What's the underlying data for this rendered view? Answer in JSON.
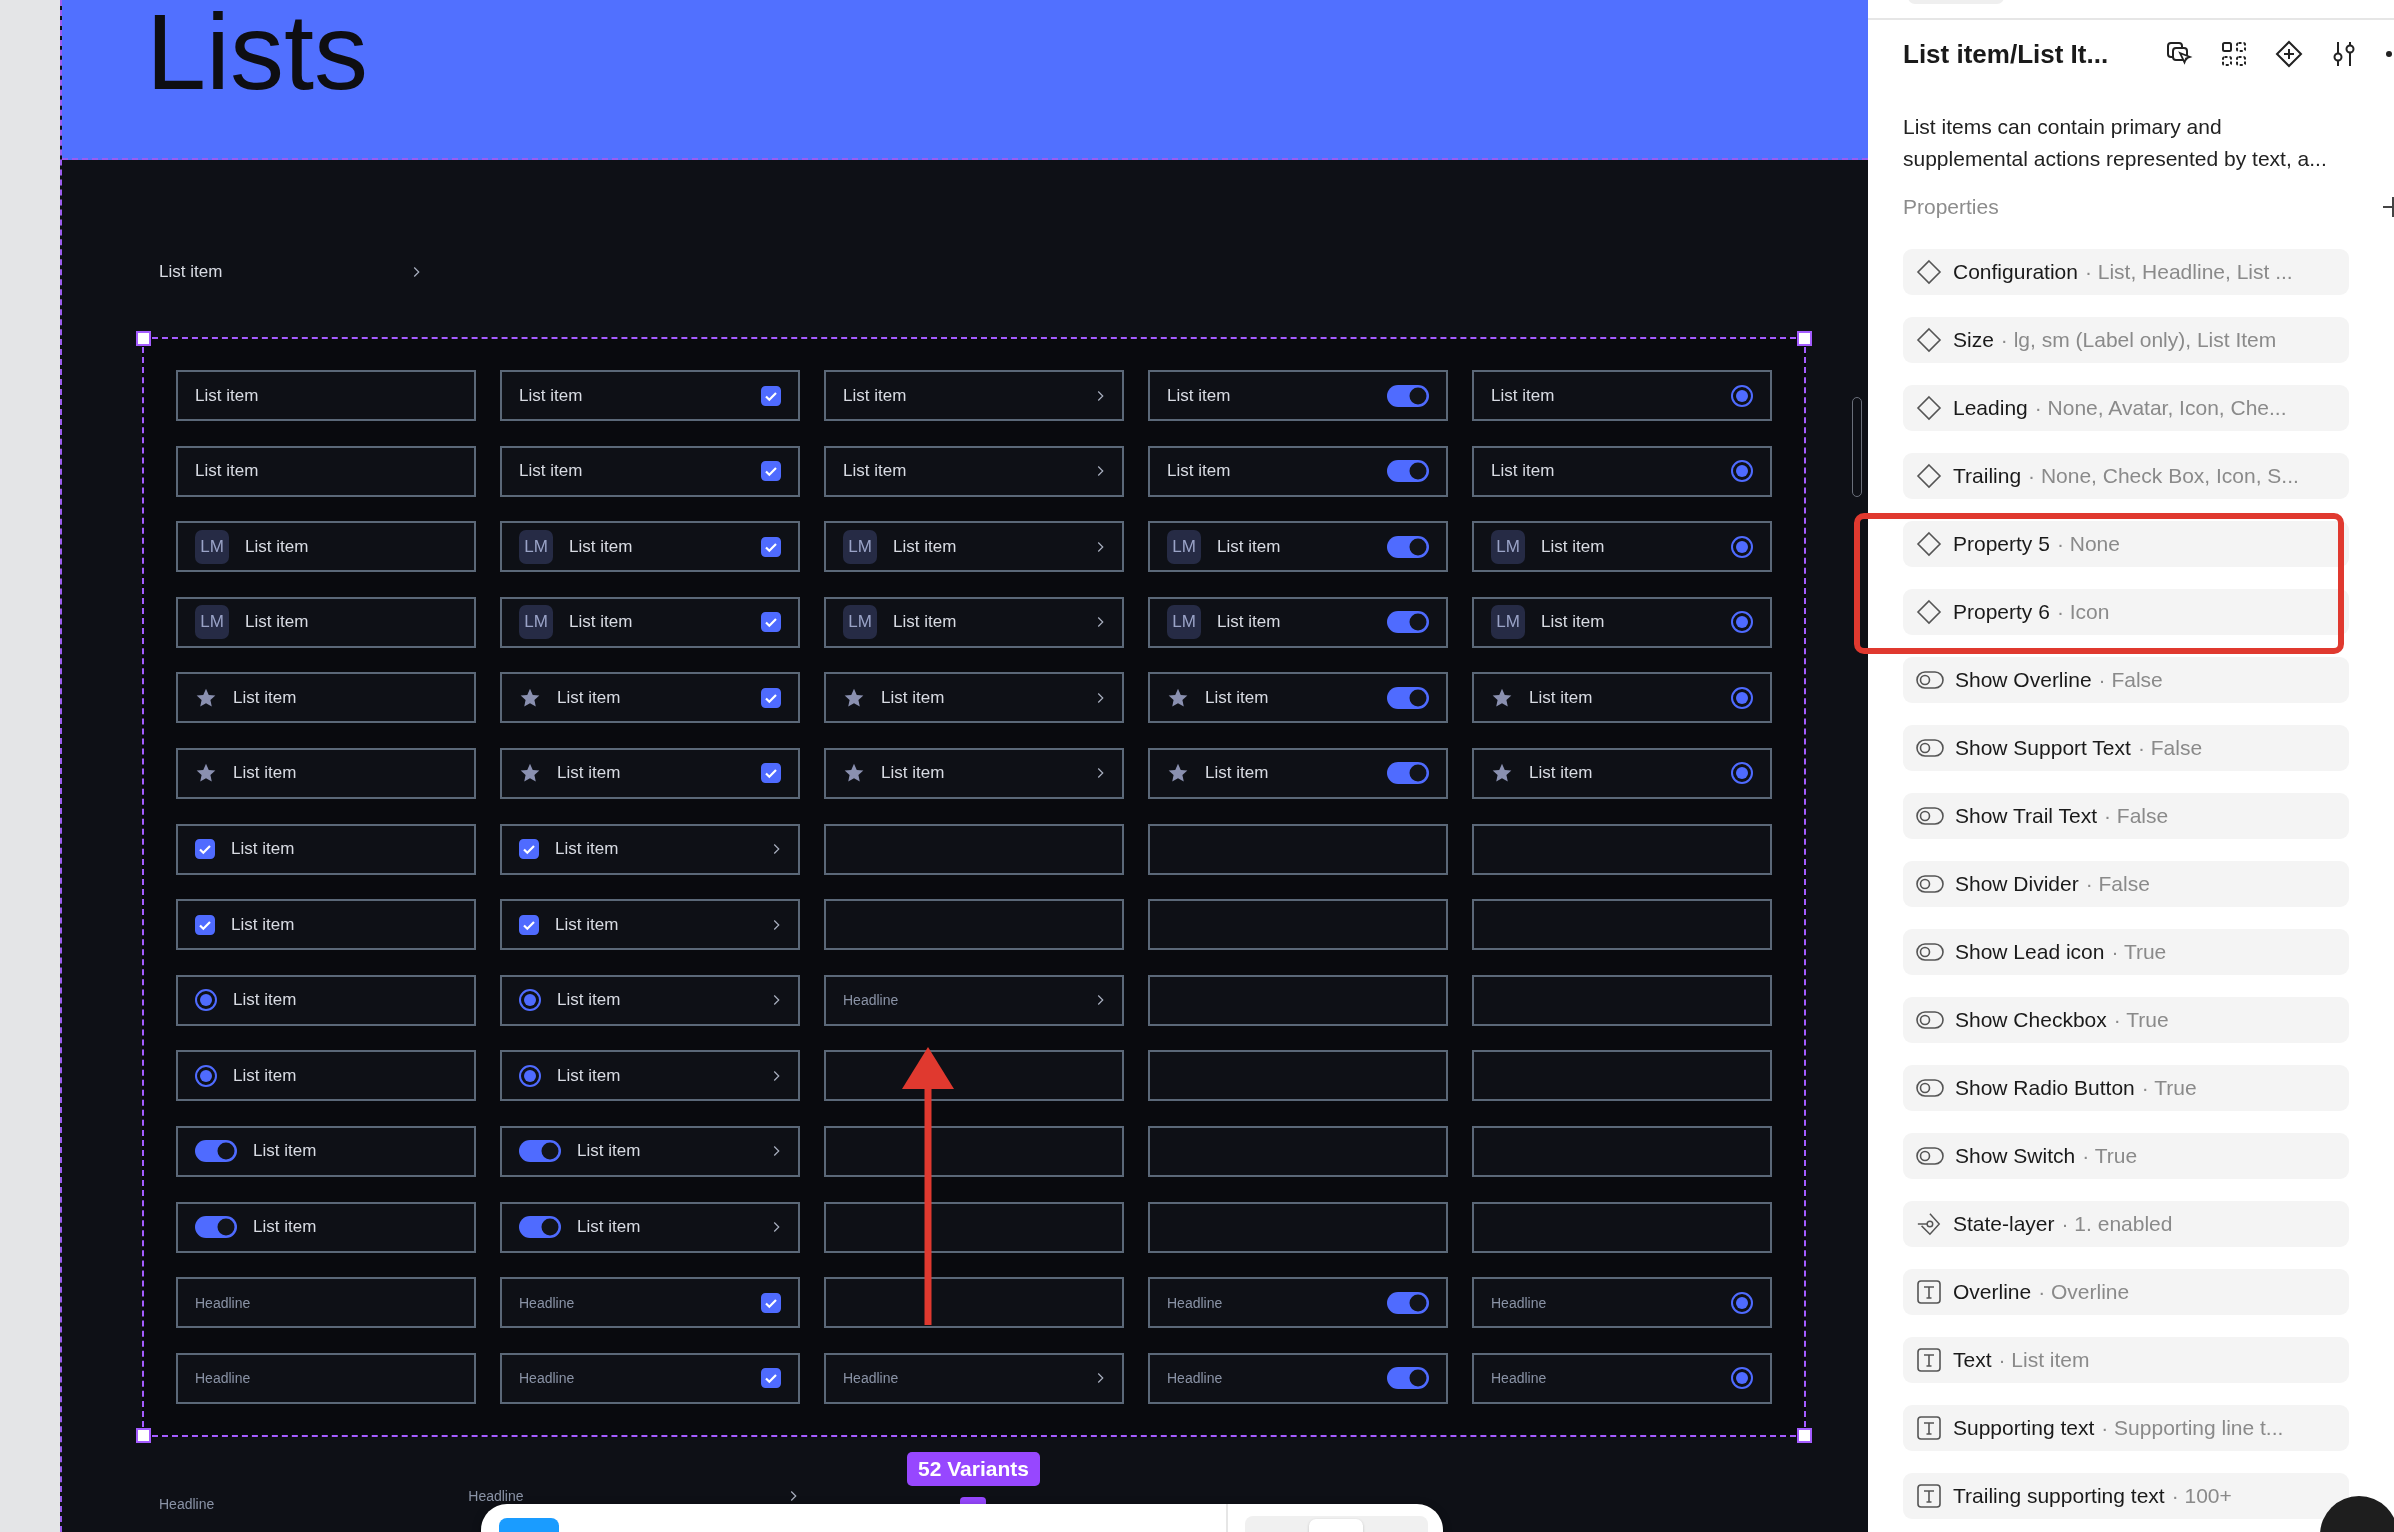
{
  "canvas": {
    "title": "Lists",
    "sample_item": {
      "label": "List item"
    },
    "variants": {
      "badge": "52 Variants",
      "rows": [
        {
          "cells": [
            {
              "kind": "item",
              "label": "List item"
            },
            {
              "kind": "item",
              "label": "List item",
              "trailing": {
                "kind": "checkbox",
                "checked": true
              }
            },
            {
              "kind": "item",
              "label": "List item",
              "trailing": {
                "kind": "chevron"
              }
            },
            {
              "kind": "item",
              "label": "List item",
              "trailing": {
                "kind": "switch",
                "checked": true
              }
            },
            {
              "kind": "item",
              "label": "List item",
              "trailing": {
                "kind": "radio",
                "checked": true
              }
            }
          ]
        },
        {
          "cells": [
            {
              "kind": "item",
              "label": "List item"
            },
            {
              "kind": "item",
              "label": "List item",
              "trailing": {
                "kind": "checkbox",
                "checked": true
              }
            },
            {
              "kind": "item",
              "label": "List item",
              "trailing": {
                "kind": "chevron"
              }
            },
            {
              "kind": "item",
              "label": "List item",
              "trailing": {
                "kind": "switch",
                "checked": true
              }
            },
            {
              "kind": "item",
              "label": "List item",
              "trailing": {
                "kind": "radio",
                "checked": true
              }
            }
          ]
        },
        {
          "cells": [
            {
              "kind": "item",
              "leading": {
                "kind": "avatar",
                "text": "LM"
              },
              "label": "List item"
            },
            {
              "kind": "item",
              "leading": {
                "kind": "avatar",
                "text": "LM"
              },
              "label": "List item",
              "trailing": {
                "kind": "checkbox",
                "checked": true
              }
            },
            {
              "kind": "item",
              "leading": {
                "kind": "avatar",
                "text": "LM"
              },
              "label": "List item",
              "trailing": {
                "kind": "chevron"
              }
            },
            {
              "kind": "item",
              "leading": {
                "kind": "avatar",
                "text": "LM"
              },
              "label": "List item",
              "trailing": {
                "kind": "switch",
                "checked": true
              }
            },
            {
              "kind": "item",
              "leading": {
                "kind": "avatar",
                "text": "LM"
              },
              "label": "List item",
              "trailing": {
                "kind": "radio",
                "checked": true
              }
            }
          ]
        },
        {
          "cells": [
            {
              "kind": "item",
              "leading": {
                "kind": "avatar",
                "text": "LM"
              },
              "label": "List item"
            },
            {
              "kind": "item",
              "leading": {
                "kind": "avatar",
                "text": "LM"
              },
              "label": "List item",
              "trailing": {
                "kind": "checkbox",
                "checked": true
              }
            },
            {
              "kind": "item",
              "leading": {
                "kind": "avatar",
                "text": "LM"
              },
              "label": "List item",
              "trailing": {
                "kind": "chevron"
              }
            },
            {
              "kind": "item",
              "leading": {
                "kind": "avatar",
                "text": "LM"
              },
              "label": "List item",
              "trailing": {
                "kind": "switch",
                "checked": true
              }
            },
            {
              "kind": "item",
              "leading": {
                "kind": "avatar",
                "text": "LM"
              },
              "label": "List item",
              "trailing": {
                "kind": "radio",
                "checked": true
              }
            }
          ]
        },
        {
          "cells": [
            {
              "kind": "item",
              "leading": {
                "kind": "star"
              },
              "label": "List item"
            },
            {
              "kind": "item",
              "leading": {
                "kind": "star"
              },
              "label": "List item",
              "trailing": {
                "kind": "checkbox",
                "checked": true
              }
            },
            {
              "kind": "item",
              "leading": {
                "kind": "star"
              },
              "label": "List item",
              "trailing": {
                "kind": "chevron"
              }
            },
            {
              "kind": "item",
              "leading": {
                "kind": "star"
              },
              "label": "List item",
              "trailing": {
                "kind": "switch",
                "checked": true
              }
            },
            {
              "kind": "item",
              "leading": {
                "kind": "star"
              },
              "label": "List item",
              "trailing": {
                "kind": "radio",
                "checked": true
              }
            }
          ]
        },
        {
          "cells": [
            {
              "kind": "item",
              "leading": {
                "kind": "star"
              },
              "label": "List item"
            },
            {
              "kind": "item",
              "leading": {
                "kind": "star"
              },
              "label": "List item",
              "trailing": {
                "kind": "checkbox",
                "checked": true
              }
            },
            {
              "kind": "item",
              "leading": {
                "kind": "star"
              },
              "label": "List item",
              "trailing": {
                "kind": "chevron"
              }
            },
            {
              "kind": "item",
              "leading": {
                "kind": "star"
              },
              "label": "List item",
              "trailing": {
                "kind": "switch",
                "checked": true
              }
            },
            {
              "kind": "item",
              "leading": {
                "kind": "star"
              },
              "label": "List item",
              "trailing": {
                "kind": "radio",
                "checked": true
              }
            }
          ]
        },
        {
          "cells": [
            {
              "kind": "item",
              "leading": {
                "kind": "checkbox",
                "checked": true
              },
              "label": "List item"
            },
            {
              "kind": "item",
              "leading": {
                "kind": "checkbox",
                "checked": true
              },
              "label": "List item",
              "trailing": {
                "kind": "chevron"
              }
            },
            {
              "kind": "empty"
            },
            {
              "kind": "empty"
            },
            {
              "kind": "empty"
            }
          ]
        },
        {
          "cells": [
            {
              "kind": "item",
              "leading": {
                "kind": "checkbox",
                "checked": true
              },
              "label": "List item"
            },
            {
              "kind": "item",
              "leading": {
                "kind": "checkbox",
                "checked": true
              },
              "label": "List item",
              "trailing": {
                "kind": "chevron"
              }
            },
            {
              "kind": "empty"
            },
            {
              "kind": "empty"
            },
            {
              "kind": "empty"
            }
          ]
        },
        {
          "cells": [
            {
              "kind": "item",
              "leading": {
                "kind": "radio",
                "checked": true
              },
              "label": "List item"
            },
            {
              "kind": "item",
              "leading": {
                "kind": "radio",
                "checked": true
              },
              "label": "List item",
              "trailing": {
                "kind": "chevron"
              }
            },
            {
              "kind": "headline",
              "label": "Headline",
              "trailing": {
                "kind": "chevron"
              }
            },
            {
              "kind": "empty"
            },
            {
              "kind": "empty"
            }
          ]
        },
        {
          "cells": [
            {
              "kind": "item",
              "leading": {
                "kind": "radio",
                "checked": true
              },
              "label": "List item"
            },
            {
              "kind": "item",
              "leading": {
                "kind": "radio",
                "checked": true
              },
              "label": "List item",
              "trailing": {
                "kind": "chevron"
              }
            },
            {
              "kind": "empty"
            },
            {
              "kind": "empty"
            },
            {
              "kind": "empty"
            }
          ]
        },
        {
          "cells": [
            {
              "kind": "item",
              "leading": {
                "kind": "switch",
                "checked": true
              },
              "label": "List item"
            },
            {
              "kind": "item",
              "leading": {
                "kind": "switch",
                "checked": true
              },
              "label": "List item",
              "trailing": {
                "kind": "chevron"
              }
            },
            {
              "kind": "empty"
            },
            {
              "kind": "empty"
            },
            {
              "kind": "empty"
            }
          ]
        },
        {
          "cells": [
            {
              "kind": "item",
              "leading": {
                "kind": "switch",
                "checked": true
              },
              "label": "List item"
            },
            {
              "kind": "item",
              "leading": {
                "kind": "switch",
                "checked": true
              },
              "label": "List item",
              "trailing": {
                "kind": "chevron"
              }
            },
            {
              "kind": "empty"
            },
            {
              "kind": "empty"
            },
            {
              "kind": "empty"
            }
          ]
        },
        {
          "cells": [
            {
              "kind": "headline",
              "label": "Headline"
            },
            {
              "kind": "headline",
              "label": "Headline",
              "trailing": {
                "kind": "checkbox",
                "checked": true
              }
            },
            {
              "kind": "empty"
            },
            {
              "kind": "headline",
              "label": "Headline",
              "trailing": {
                "kind": "switch",
                "checked": true
              }
            },
            {
              "kind": "headline",
              "label": "Headline",
              "trailing": {
                "kind": "radio",
                "checked": true
              }
            }
          ]
        },
        {
          "cells": [
            {
              "kind": "headline",
              "label": "Headline"
            },
            {
              "kind": "headline",
              "label": "Headline",
              "trailing": {
                "kind": "checkbox",
                "checked": true
              }
            },
            {
              "kind": "headline",
              "label": "Headline",
              "trailing": {
                "kind": "chevron"
              }
            },
            {
              "kind": "headline",
              "label": "Headline",
              "trailing": {
                "kind": "switch",
                "checked": true
              }
            },
            {
              "kind": "headline",
              "label": "Headline",
              "trailing": {
                "kind": "radio",
                "checked": true
              }
            }
          ]
        }
      ]
    },
    "below": [
      {
        "label": "Headline"
      },
      {
        "label": "Headline",
        "trailing": {
          "kind": "chevron"
        }
      }
    ]
  },
  "panel": {
    "title": "List item/List It...",
    "description": "List items can contain primary and\nsupplemental actions represented by text, a...",
    "section": "Properties",
    "properties": [
      {
        "kind": "variant",
        "name": "Configuration",
        "value": "· List, Headline, List ..."
      },
      {
        "kind": "variant",
        "name": "Size",
        "value": "· lg, sm (Label only), List Item"
      },
      {
        "kind": "variant",
        "name": "Leading",
        "value": "· None, Avatar, Icon, Che..."
      },
      {
        "kind": "variant",
        "name": "Trailing",
        "value": "· None, Check Box, Icon, S..."
      },
      {
        "kind": "variant",
        "name": "Property 5",
        "value": "· None"
      },
      {
        "kind": "variant",
        "name": "Property 6",
        "value": "· Icon"
      },
      {
        "kind": "boolean",
        "name": "Show Overline",
        "value": "· False"
      },
      {
        "kind": "boolean",
        "name": "Show Support Text",
        "value": "· False"
      },
      {
        "kind": "boolean",
        "name": "Show Trail Text",
        "value": "· False"
      },
      {
        "kind": "boolean",
        "name": "Show Divider",
        "value": "· False"
      },
      {
        "kind": "boolean",
        "name": "Show Lead icon",
        "value": "· True"
      },
      {
        "kind": "boolean",
        "name": "Show Checkbox",
        "value": "· True"
      },
      {
        "kind": "boolean",
        "name": "Show Radio Button",
        "value": "· True"
      },
      {
        "kind": "boolean",
        "name": "Show Switch",
        "value": "· True"
      },
      {
        "kind": "state",
        "name": "State-layer",
        "value": "· 1. enabled"
      },
      {
        "kind": "text",
        "name": "Overline",
        "value": "· Overline"
      },
      {
        "kind": "text",
        "name": "Text",
        "value": "· List item"
      },
      {
        "kind": "text",
        "name": "Supporting text",
        "value": "· Supporting line t..."
      },
      {
        "kind": "text",
        "name": "Trailing supporting text",
        "value": "· 100+"
      }
    ]
  }
}
